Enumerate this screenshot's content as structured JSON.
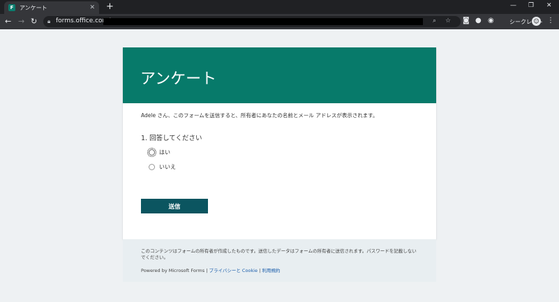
{
  "browser": {
    "tab_title": "アンケート",
    "url": "forms.office.com/",
    "incognito_label": "シークレット"
  },
  "form": {
    "title": "アンケート",
    "notice": "Adele さん、このフォームを送信すると、所有者にあなたの名前とメール アドレスが表示されます。",
    "question": "1. 回答してください",
    "options": [
      {
        "label": "はい"
      },
      {
        "label": "いいえ"
      }
    ],
    "submit_label": "送信",
    "header_color": "#077a6a",
    "button_color": "#0b5560"
  },
  "footer": {
    "disclaimer": "このコンテンツはフォームの所有者が作成したものです。送信したデータはフォームの所有者に送信されます。パスワードを記載しないでください。",
    "powered_by": "Powered by Microsoft Forms |",
    "privacy_link": "プライバシーと Cookie",
    "separator": "|",
    "terms_link": "利用規約"
  }
}
